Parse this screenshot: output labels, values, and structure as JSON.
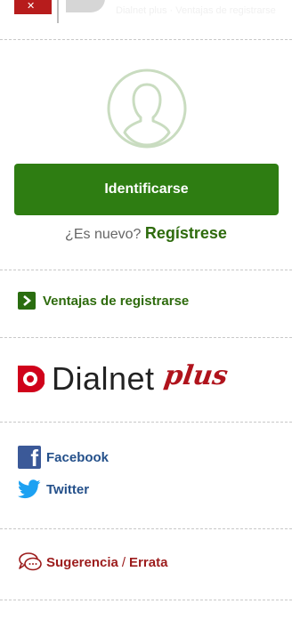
{
  "header": {
    "faint_text": "Dialnet plus · Ventajas de registrarse"
  },
  "login": {
    "button_label": "Identificarse",
    "question": "¿Es nuevo?",
    "register_link": "Regístrese"
  },
  "advantages": {
    "link_label": "Ventajas de registrarse"
  },
  "brand": {
    "name": "Dialnet",
    "suffix": "plus"
  },
  "social": {
    "facebook_label": "Facebook",
    "twitter_label": "Twitter"
  },
  "feedback": {
    "suggestion_label": "Sugerencia",
    "separator": "/",
    "erratum_label": "Errata"
  },
  "colors": {
    "primary_green": "#2e7d12",
    "link_green": "#2e6b0d",
    "facebook_blue": "#3b5998",
    "twitter_blue": "#1da1f2",
    "feedback_red": "#9c1c1c",
    "dialnet_red": "#d0021b"
  },
  "icons": {
    "avatar": "user-avatar-icon",
    "advantages": "chevron-right-icon",
    "facebook": "facebook-icon",
    "twitter": "twitter-icon",
    "feedback": "speech-bubble-icon"
  }
}
